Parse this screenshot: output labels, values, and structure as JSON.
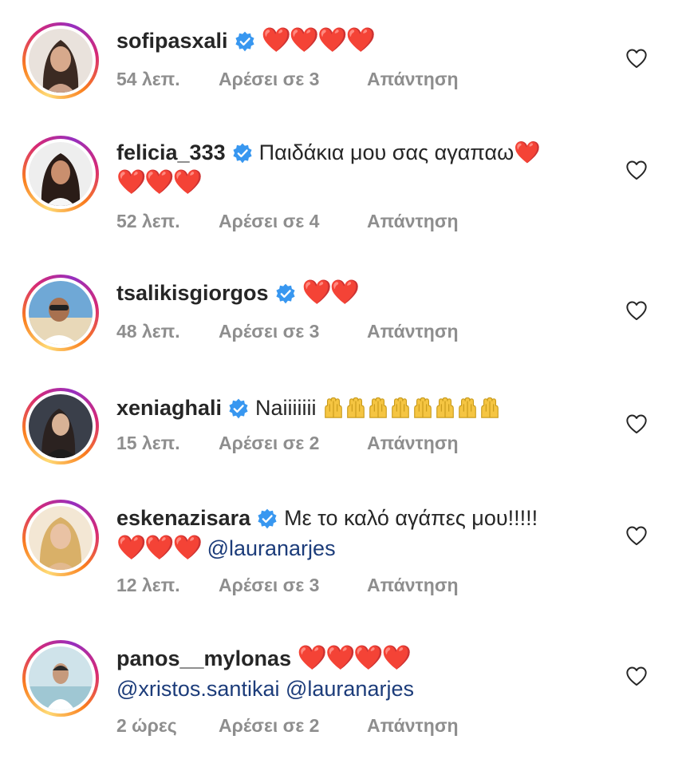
{
  "comments": [
    {
      "username": "sofipasxali",
      "text": "",
      "hearts": "❤️❤️❤️❤️",
      "line2": "",
      "time": "54 λεπ.",
      "likes": "Αρέσει σε 3",
      "reply": "Απάντηση"
    },
    {
      "username": "felicia_333",
      "text": "Παιδάκια μου σας αγαπαω❤️",
      "hearts": "",
      "line2": "❤️❤️❤️",
      "time": "52 λεπ.",
      "likes": "Αρέσει σε 4",
      "reply": "Απάντηση"
    },
    {
      "username": "tsalikisgiorgos",
      "text": "",
      "hearts": "❤️❤️",
      "line2": "",
      "time": "48 λεπ.",
      "likes": "Αρέσει σε 3",
      "reply": "Απάντηση"
    },
    {
      "username": "xeniaghali",
      "text": "Naiiiiiii",
      "hearts": "",
      "line2": "",
      "time": "15 λεπ.",
      "likes": "Αρέσει σε 2",
      "reply": "Απάντηση"
    },
    {
      "username": "eskenazisara",
      "text": "Με το καλό αγάπες μου!!!!!",
      "hearts": "",
      "line2": "❤️❤️❤️",
      "mention": "@lauranarjes",
      "time": "12 λεπ.",
      "likes": "Αρέσει σε 3",
      "reply": "Απάντηση"
    },
    {
      "username": "panos__mylonas",
      "text": "",
      "hearts": "❤️❤️❤️❤️",
      "line2": "",
      "mention1": "@xristos.santikai",
      "mention2": "@lauranarjes",
      "time": "2 ώρες",
      "likes": "Αρέσει σε 2",
      "reply": "Απάντηση"
    }
  ],
  "colors": {
    "verified": "#3897f0",
    "heart": "#e0252d",
    "meta": "#8e8e8e",
    "mention": "#1c3c7a"
  },
  "icons": {
    "verified": "verified-badge-icon",
    "like": "heart-outline-icon",
    "clap": "raising-hands-emoji"
  }
}
